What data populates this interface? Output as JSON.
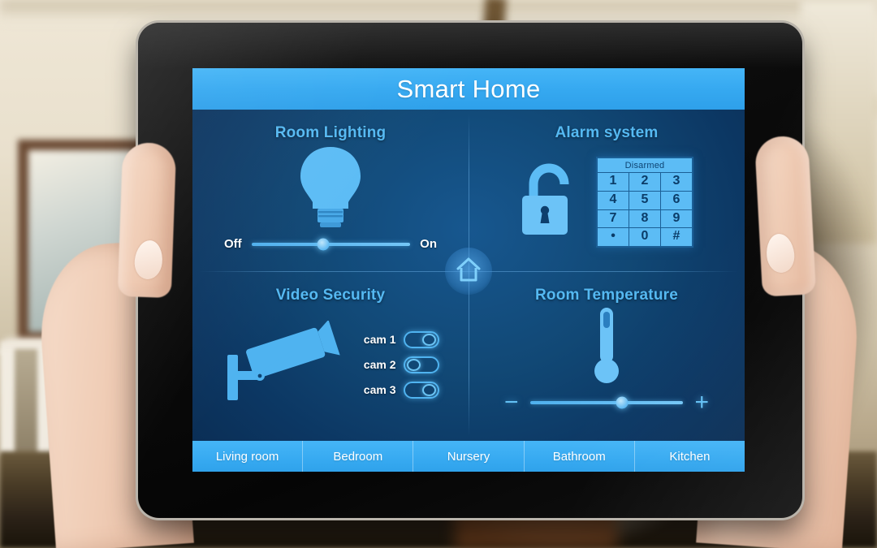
{
  "device": {
    "name": "tablet"
  },
  "app": {
    "title": "Smart Home"
  },
  "panels": {
    "room_lighting": {
      "title": "Room Lighting",
      "icon": "light-bulb-icon",
      "slider": {
        "min_label": "Off",
        "max_label": "On",
        "value_percent": 45
      }
    },
    "alarm_system": {
      "title": "Alarm system",
      "icon": "open-padlock-icon",
      "keypad": {
        "status": "Disarmed",
        "rows": [
          [
            "1",
            "2",
            "3"
          ],
          [
            "4",
            "5",
            "6"
          ],
          [
            "7",
            "8",
            "9"
          ],
          [
            "•",
            "0",
            "#"
          ]
        ]
      }
    },
    "video_security": {
      "title": "Video Security",
      "icon": "cctv-camera-icon",
      "cameras": [
        {
          "label": "cam 1",
          "state": "on"
        },
        {
          "label": "cam 2",
          "state": "off"
        },
        {
          "label": "cam 3",
          "state": "on"
        }
      ]
    },
    "room_temperature": {
      "title": "Room Temperature",
      "icon": "thermometer-icon",
      "slider": {
        "min_label": "−",
        "max_label": "+",
        "value_percent": 60
      }
    }
  },
  "home_button": {
    "icon": "house-icon"
  },
  "tabs": [
    {
      "label": "Living room"
    },
    {
      "label": "Bedroom"
    },
    {
      "label": "Nursery"
    },
    {
      "label": "Bathroom"
    },
    {
      "label": "Kitchen"
    }
  ],
  "colors": {
    "accent": "#45b5f7",
    "screen_bg": "#114875",
    "title_text": "#ffffff",
    "panel_title": "#55b9f2",
    "keypad_bg": "#5cbcf5",
    "keypad_text": "#0b3c68"
  }
}
